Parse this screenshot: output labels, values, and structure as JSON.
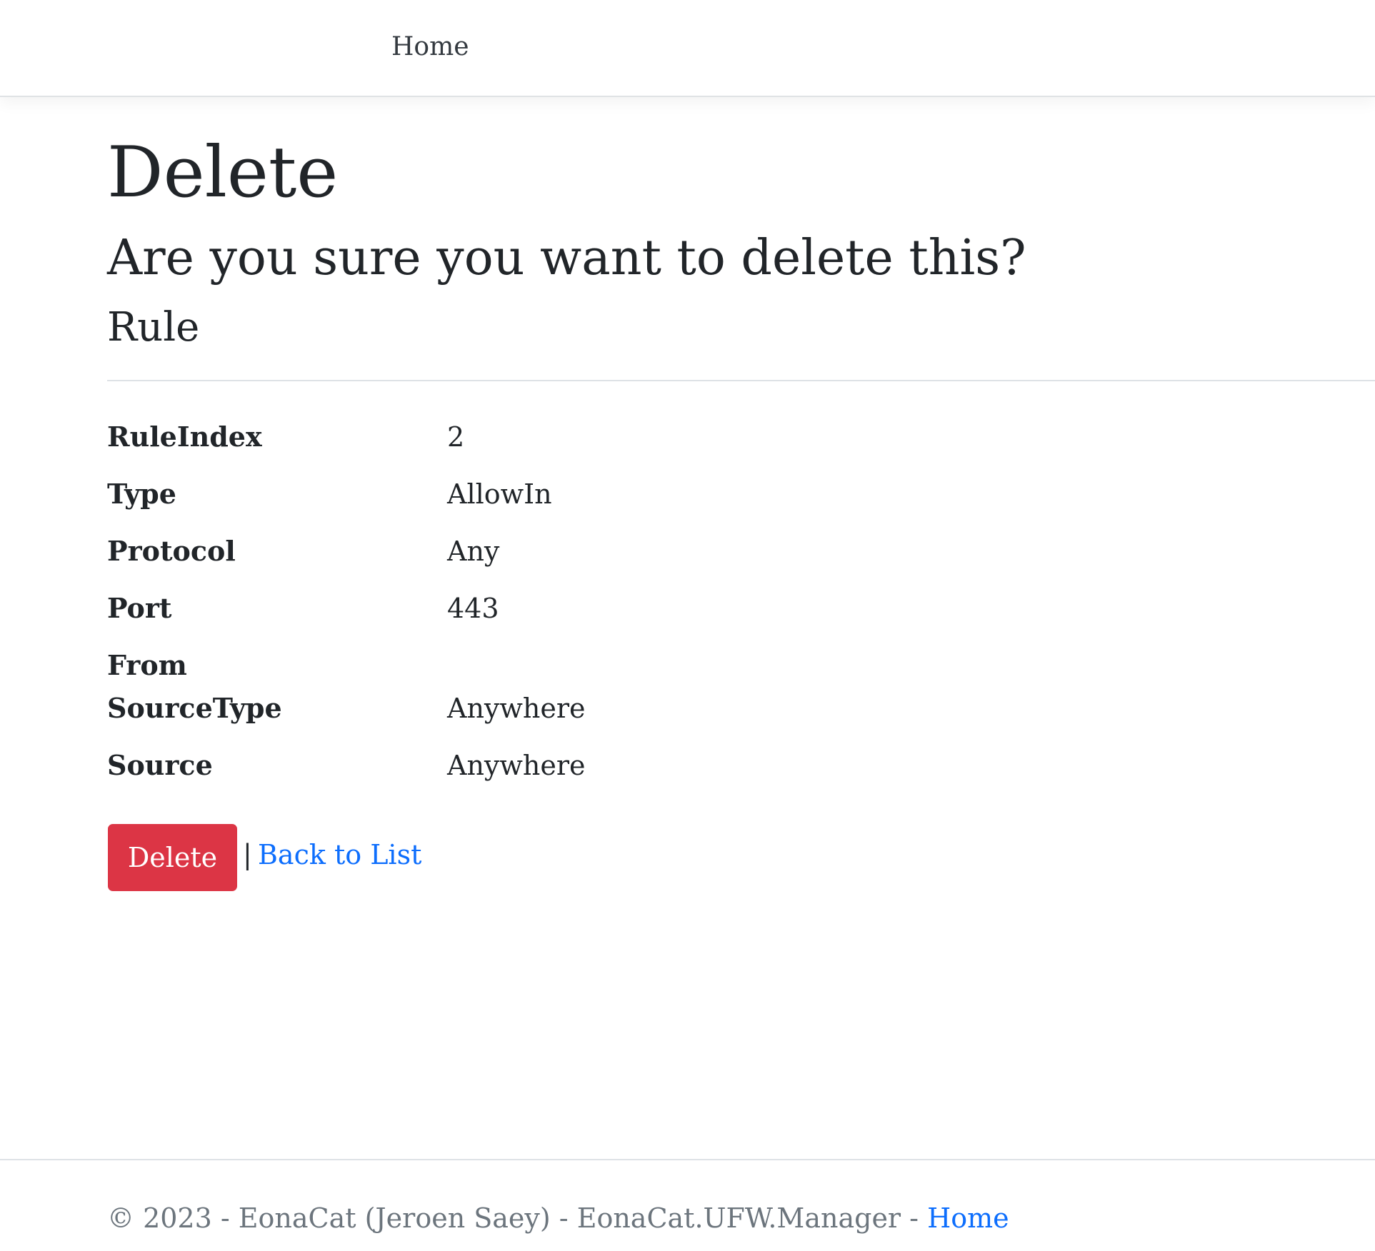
{
  "navbar": {
    "home_label": "Home"
  },
  "page": {
    "title": "Delete",
    "confirm_text": "Are you sure you want to delete this?",
    "entity_name": "Rule"
  },
  "details": {
    "rule_index": {
      "label": "RuleIndex",
      "value": "2"
    },
    "type": {
      "label": "Type",
      "value": "AllowIn"
    },
    "protocol": {
      "label": "Protocol",
      "value": "Any"
    },
    "port": {
      "label": "Port",
      "value": "443"
    },
    "from": {
      "label": "From",
      "value": ""
    },
    "source_type": {
      "label": "SourceType",
      "value": "Anywhere"
    },
    "source": {
      "label": "Source",
      "value": "Anywhere"
    }
  },
  "actions": {
    "delete_label": "Delete",
    "separator": "|",
    "back_label": "Back to List"
  },
  "footer": {
    "text": "© 2023 - EonaCat (Jeroen Saey) - EonaCat.UFW.Manager - ",
    "home_label": "Home"
  },
  "colors": {
    "danger": "#dc3545",
    "link": "#0d6efd",
    "muted": "#6c757d",
    "text": "#212529"
  }
}
